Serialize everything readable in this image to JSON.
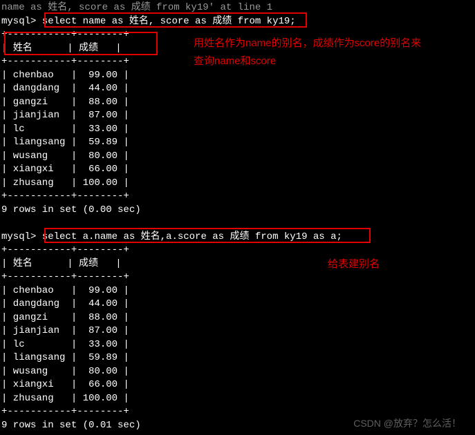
{
  "top_error": "name as 姓名, score as 成绩 from ky19' at line 1",
  "prompt": "mysql>",
  "query1": "select name as 姓名, score as 成绩 from ky19;",
  "query2": "select a.name as 姓名,a.score as 成绩 from ky19 as a;",
  "table_border": "+-----------+--------+",
  "header_border": "+-----------+--------+",
  "header": {
    "col1": "姓名",
    "col2": "成绩"
  },
  "rows": [
    {
      "name": "chenbao",
      "score": "99.00"
    },
    {
      "name": "dangdang",
      "score": "44.00"
    },
    {
      "name": "gangzi",
      "score": "88.00"
    },
    {
      "name": "jianjian",
      "score": "87.00"
    },
    {
      "name": "lc",
      "score": "33.00"
    },
    {
      "name": "liangsang",
      "score": "59.89"
    },
    {
      "name": "wusang",
      "score": "80.00"
    },
    {
      "name": "xiangxi",
      "score": "66.00"
    },
    {
      "name": "zhusang",
      "score": "100.00"
    }
  ],
  "result1": "9 rows in set (0.00 sec)",
  "result2": "9 rows in set (0.01 sec)",
  "annotation1": "用姓名作为name的别名，成绩作为score的别名来查询name和score",
  "annotation2": "给表建别名",
  "watermark": "CSDN @放弃？怎么活！"
}
